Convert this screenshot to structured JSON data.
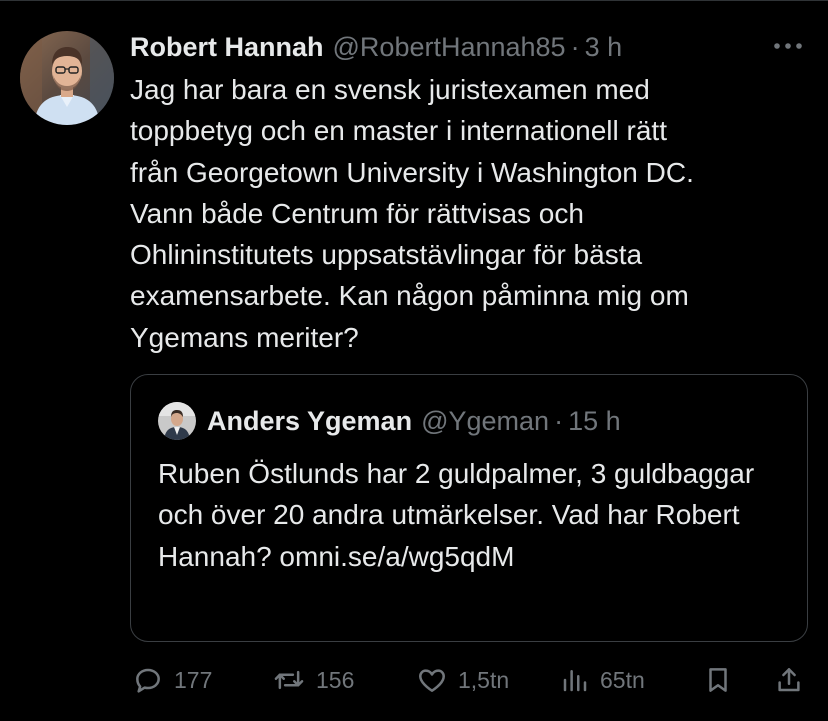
{
  "tweet": {
    "author": {
      "name": "Robert Hannah",
      "handle": "@RobertHannah85"
    },
    "separator": "·",
    "time": "3 h",
    "text": "Jag har bara en svensk juristexamen med\ntoppbetyg och en master i internationell rätt\nfrån Georgetown University i Washington DC.\nVann både Centrum för rättvisas och\nOhlininstitutets uppsatstävlingar för bästa\nexamensarbete. Kan någon påminna mig om\nYgemans meriter?"
  },
  "quoted": {
    "author": {
      "name": "Anders Ygeman",
      "handle": "@Ygeman"
    },
    "separator": "·",
    "time": "15 h",
    "text": "Ruben Östlunds har 2 guldpalmer, 3 guldbaggar och över 20 andra utmärkelser. Vad har Robert Hannah? omni.se/a/wg5qdM"
  },
  "actions": {
    "replies": "177",
    "reposts": "156",
    "likes": "1,5tn",
    "views": "65tn"
  },
  "colors": {
    "background": "#000000",
    "text": "#e7e9ea",
    "muted": "#71767b",
    "border": "#3a3e42"
  },
  "icons": [
    "more-icon",
    "reply-icon",
    "repost-icon",
    "like-icon",
    "views-icon",
    "bookmark-icon",
    "share-icon"
  ]
}
